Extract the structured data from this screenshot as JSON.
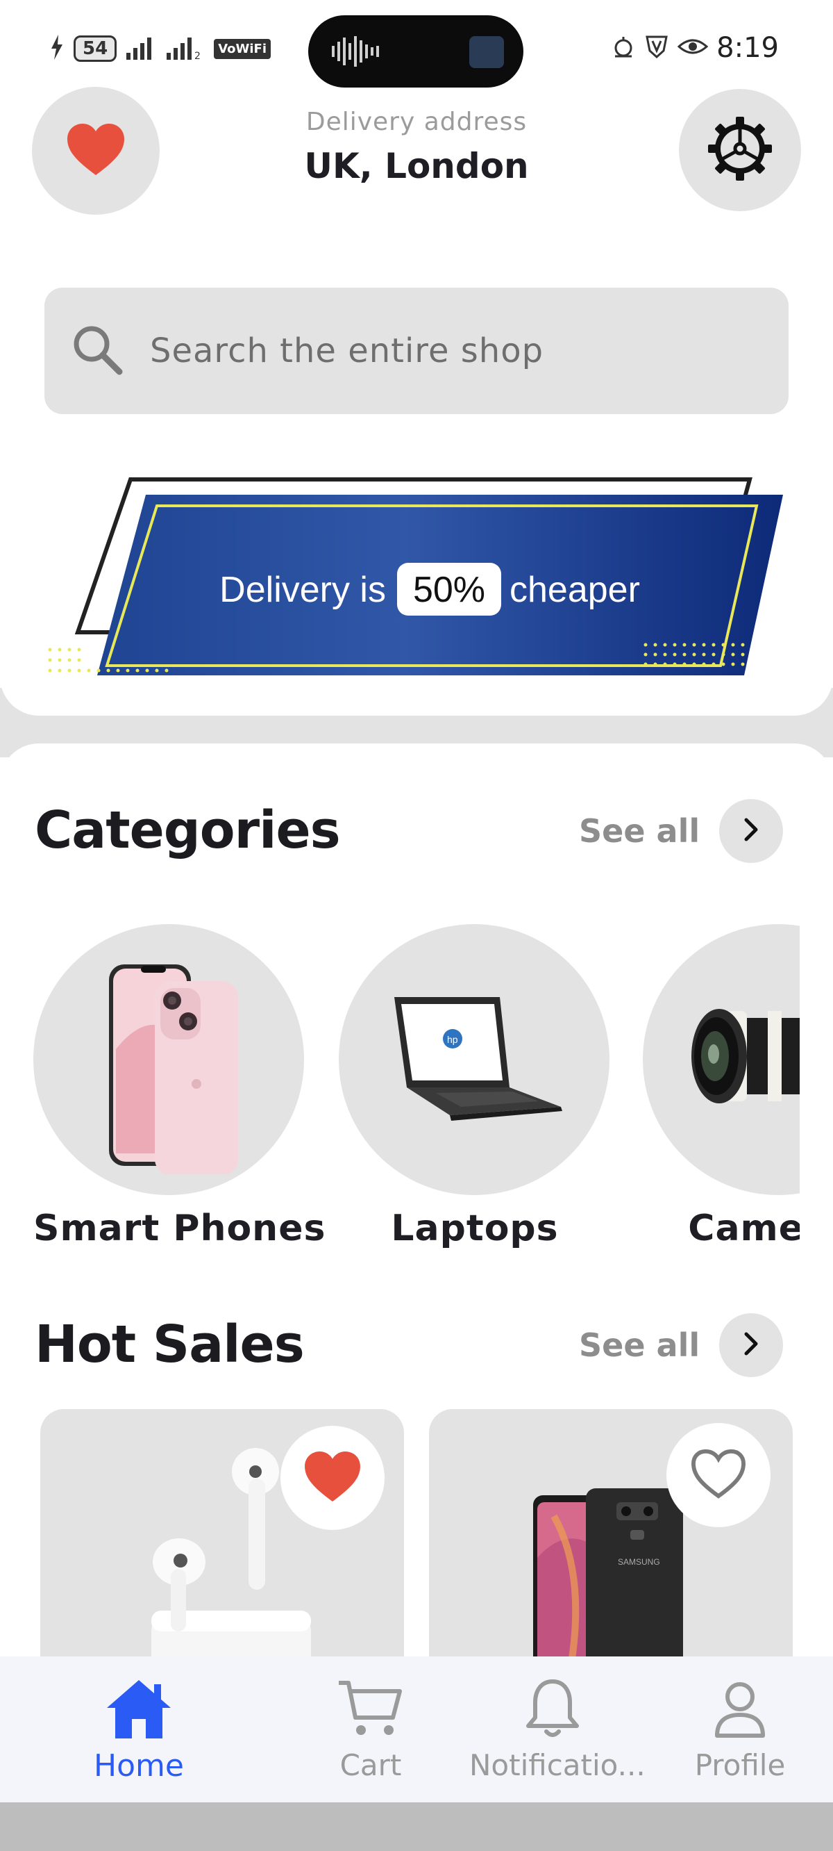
{
  "status_bar": {
    "battery": "54",
    "network_badge": "VoWiFi",
    "time": "8:19"
  },
  "header": {
    "delivery_label": "Delivery address",
    "delivery_value": "UK, London"
  },
  "search": {
    "placeholder": "Search the entire shop"
  },
  "banner": {
    "text_before": "Delivery is",
    "highlight": "50%",
    "text_after": "cheaper"
  },
  "categories": {
    "title": "Categories",
    "see_all": "See all",
    "items": [
      {
        "label": "Smart Phones",
        "icon": "phone-image"
      },
      {
        "label": "Laptops",
        "icon": "laptop-image"
      },
      {
        "label": "Cameras",
        "icon": "camera-image"
      }
    ]
  },
  "hot_sales": {
    "title": "Hot Sales",
    "see_all": "See all",
    "products": [
      {
        "image": "earbuds-image",
        "favorited": true
      },
      {
        "image": "smartphone-image",
        "favorited": false
      }
    ]
  },
  "nav": {
    "items": [
      {
        "label": "Home",
        "icon": "home-icon",
        "active": true
      },
      {
        "label": "Cart",
        "icon": "cart-icon",
        "active": false
      },
      {
        "label": "Notificatio...",
        "icon": "bell-icon",
        "active": false
      },
      {
        "label": "Profile",
        "icon": "user-icon",
        "active": false
      }
    ]
  },
  "colors": {
    "accent": "#2a5cf5",
    "heart": "#e8503e",
    "card_bg": "#e3e3e3",
    "banner_blue": "#1b3f8f"
  }
}
